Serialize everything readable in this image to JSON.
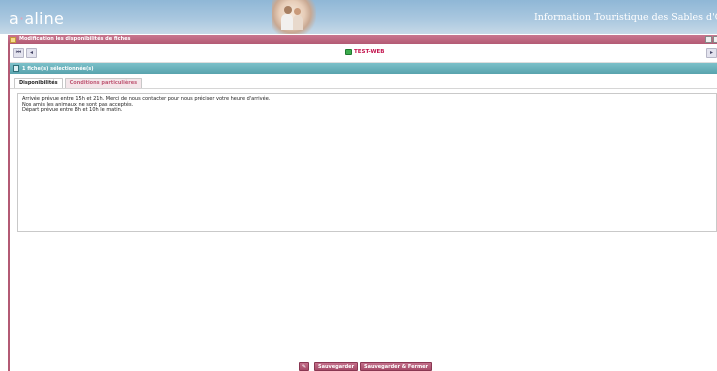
{
  "banner": {
    "logo_prefix": "a",
    "logo_dot": "·",
    "logo_suffix": "aline",
    "site_title": "Information Touristique des Sables d'Olonne"
  },
  "window": {
    "title": "Modification les disponibilités de fiches"
  },
  "toolbar": {
    "first_label": "⏮",
    "prev_label": "◂",
    "record_name": "TEST-WEB",
    "next_label": "▸"
  },
  "selection": {
    "label": "1 fiche(s) sélectionnée(s)"
  },
  "tabs": [
    {
      "label": "Disponibilités",
      "active": true
    },
    {
      "label": "Conditions particulières",
      "active": false
    }
  ],
  "textarea": {
    "lines": [
      "Arrivée prévue entre 15h et 21h. Merci de nous contacter pour nous préciser votre heure d'arrivée.",
      "Nos amis les animaux ne sont pas acceptés.",
      "Départ prévue entre 8h et 10h le matin."
    ]
  },
  "footer": {
    "save_label": "Sauvegarder",
    "save_close_label": "Sauvegarder & Fermer"
  },
  "colors": {
    "accent_pink": "#b35a74",
    "teal_bar": "#58a3ad",
    "record_name": "#c3144d"
  }
}
